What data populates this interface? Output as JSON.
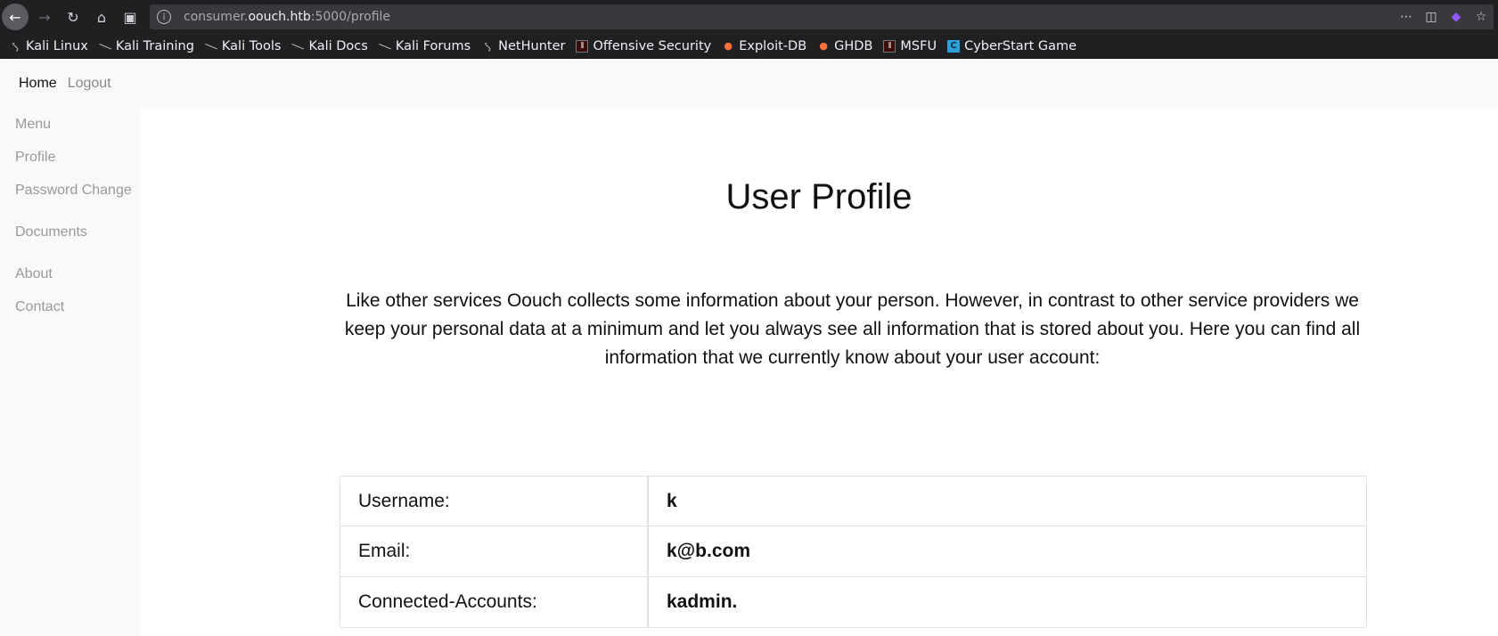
{
  "browser": {
    "url_prefix": "consumer.",
    "url_host": "oouch.htb",
    "url_suffix": ":5000/profile",
    "bookmarks": [
      {
        "label": "Kali Linux",
        "icon": "kali-dragon-icon"
      },
      {
        "label": "Kali Training",
        "icon": "kali-tool-icon"
      },
      {
        "label": "Kali Tools",
        "icon": "kali-tool-icon"
      },
      {
        "label": "Kali Docs",
        "icon": "kali-tool-icon"
      },
      {
        "label": "Kali Forums",
        "icon": "kali-tool-icon"
      },
      {
        "label": "NetHunter",
        "icon": "kali-dragon-icon"
      },
      {
        "label": "Offensive Security",
        "icon": "offsec-icon"
      },
      {
        "label": "Exploit-DB",
        "icon": "exploit-db-icon"
      },
      {
        "label": "GHDB",
        "icon": "exploit-db-icon"
      },
      {
        "label": "MSFU",
        "icon": "offsec-icon"
      },
      {
        "label": "CyberStart Game",
        "icon": "cyberstart-icon"
      }
    ]
  },
  "topnav": {
    "home": "Home",
    "logout": "Logout"
  },
  "sidebar": {
    "items": [
      "Menu",
      "Profile",
      "Password Change",
      "Documents",
      "About",
      "Contact"
    ]
  },
  "main": {
    "title": "User Profile",
    "intro": "Like other services Oouch collects some information about your person. However, in contrast to other service providers we keep your personal data at a minimum and let you always see all information that is stored about you. Here you can find all information that we currently know about your user account:",
    "rows": [
      {
        "label": "Username:",
        "value": "k"
      },
      {
        "label": "Email:",
        "value": "k@b.com"
      },
      {
        "label": "Connected-Accounts:",
        "value": "kadmin."
      }
    ]
  },
  "colors": {
    "chrome": "#202023",
    "page_bg": "#f8f9fa",
    "content_bg": "#ffffff",
    "border": "#dee2e6"
  }
}
